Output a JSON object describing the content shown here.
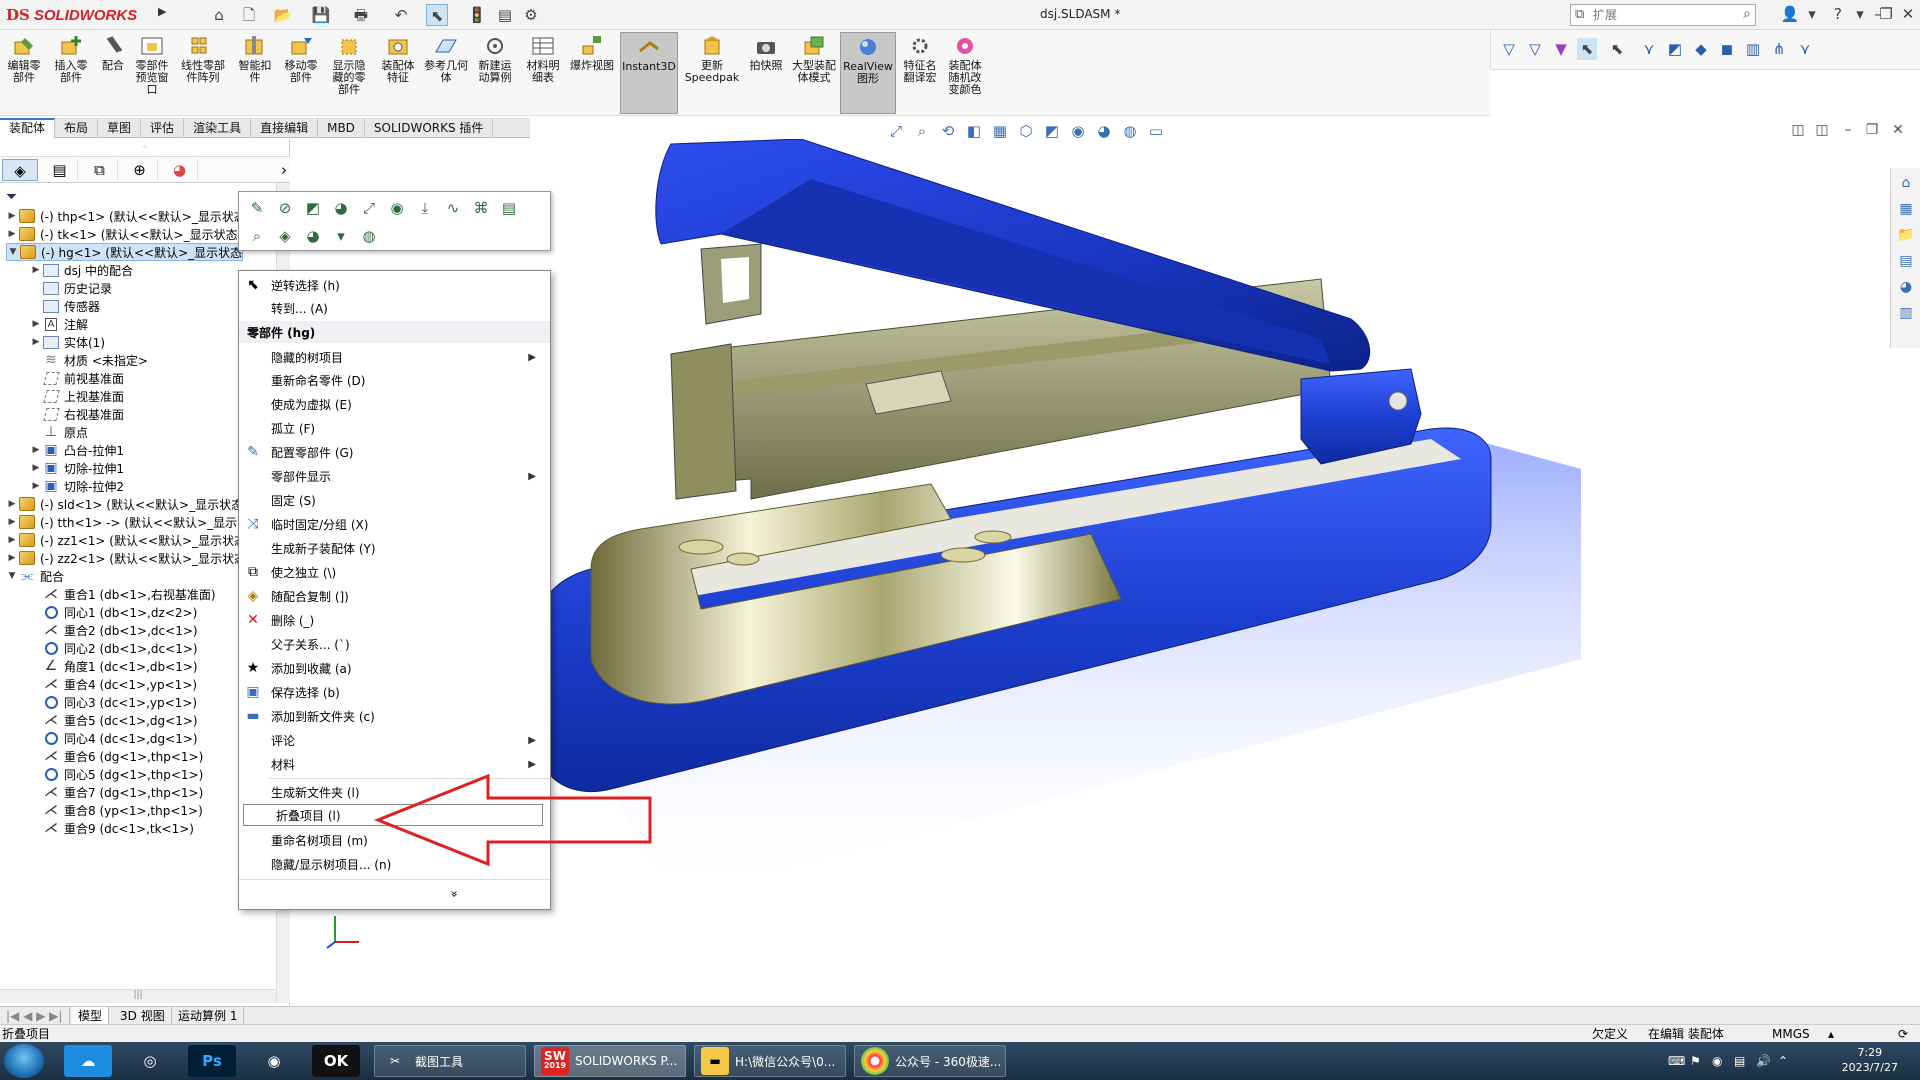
{
  "titlebar": {
    "brand_mark": "DS",
    "brand_name": "SOLIDWORKS",
    "doc_title": "dsj.SLDASM *",
    "search_placeholder": "扩展",
    "help_label": "?"
  },
  "command_manager": {
    "commands": [
      {
        "label": "编辑零部件"
      },
      {
        "label": "插入零部件"
      },
      {
        "label": "配合"
      },
      {
        "label": "零部件预览窗口"
      },
      {
        "label": "线性零部件阵列"
      },
      {
        "label": "智能扣件"
      },
      {
        "label": "移动零部件"
      },
      {
        "label": "显示隐藏的零部件"
      },
      {
        "label": "装配体特征"
      },
      {
        "label": "参考几何体"
      },
      {
        "label": "新建运动算例"
      },
      {
        "label": "材料明细表"
      },
      {
        "label": "爆炸视图"
      },
      {
        "label": "Instant3D"
      },
      {
        "label": "更新Speedpak"
      },
      {
        "label": "拍快照"
      },
      {
        "label": "大型装配体模式"
      },
      {
        "label": "RealView图形"
      },
      {
        "label": "特征名翻译宏"
      },
      {
        "label": "装配体随机改变颜色"
      }
    ]
  },
  "tabs": [
    "装配体",
    "布局",
    "草图",
    "评估",
    "渲染工具",
    "直接编辑",
    "MBD",
    "SOLIDWORKS 插件"
  ],
  "tree": {
    "items": [
      {
        "label": "(-) thp<1> (默认<<默认>_显示状态"
      },
      {
        "label": "(-) tk<1> (默认<<默认>_显示状态"
      },
      {
        "label": "(-) hg<1> (默认<<默认>_显示状态"
      },
      {
        "label": "dsj 中的配合"
      },
      {
        "label": "历史记录"
      },
      {
        "label": "传感器"
      },
      {
        "label": "注解"
      },
      {
        "label": "实体(1)"
      },
      {
        "label": "材质 <未指定>"
      },
      {
        "label": "前视基准面"
      },
      {
        "label": "上视基准面"
      },
      {
        "label": "右视基准面"
      },
      {
        "label": "原点"
      },
      {
        "label": "凸台-拉伸1"
      },
      {
        "label": "切除-拉伸1"
      },
      {
        "label": "切除-拉伸2"
      },
      {
        "label": "(-) sld<1> (默认<<默认>_显示状态"
      },
      {
        "label": "(-) tth<1> -> (默认<<默认>_显示"
      },
      {
        "label": "(-) zz1<1> (默认<<默认>_显示状态"
      },
      {
        "label": "(-) zz2<1> (默认<<默认>_显示状态"
      },
      {
        "label": "配合"
      },
      {
        "label": "重合1 (db<1>,右视基准面)"
      },
      {
        "label": "同心1 (db<1>,dz<2>)"
      },
      {
        "label": "重合2 (db<1>,dc<1>)"
      },
      {
        "label": "同心2 (db<1>,dc<1>)"
      },
      {
        "label": "角度1 (dc<1>,db<1>)"
      },
      {
        "label": "重合4 (dc<1>,yp<1>)"
      },
      {
        "label": "同心3 (dc<1>,yp<1>)"
      },
      {
        "label": "重合5 (dc<1>,dg<1>)"
      },
      {
        "label": "同心4 (dc<1>,dg<1>)"
      },
      {
        "label": "重合6 (dg<1>,thp<1>)"
      },
      {
        "label": "同心5 (dg<1>,thp<1>)"
      },
      {
        "label": "重合7 (dg<1>,thp<1>)"
      },
      {
        "label": "重合8 (yp<1>,thp<1>)"
      },
      {
        "label": "重合9 (dc<1>,tk<1>)"
      }
    ]
  },
  "context_menu": {
    "items": [
      {
        "label": "逆转选择 (h)"
      },
      {
        "label": "转到... (A)"
      },
      {
        "label": "零部件 (hg)"
      },
      {
        "label": "隐藏的树项目"
      },
      {
        "label": "重新命名零件 (D)"
      },
      {
        "label": "使成为虚拟 (E)"
      },
      {
        "label": "孤立 (F)"
      },
      {
        "label": "配置零部件 (G)"
      },
      {
        "label": "零部件显示"
      },
      {
        "label": "固定 (S)"
      },
      {
        "label": "临时固定/分组 (X)"
      },
      {
        "label": "生成新子装配体 (Y)"
      },
      {
        "label": "使之独立 (\\)"
      },
      {
        "label": "随配合复制 (])"
      },
      {
        "label": "删除 (_)"
      },
      {
        "label": "父子关系... (`)"
      },
      {
        "label": "添加到收藏 (a)"
      },
      {
        "label": "保存选择 (b)"
      },
      {
        "label": "添加到新文件夹 (c)"
      },
      {
        "label": "评论"
      },
      {
        "label": "材料"
      },
      {
        "label": "生成新文件夹 (l)"
      },
      {
        "label": "折叠项目 (l)"
      },
      {
        "label": "重命名树项目 (m)"
      },
      {
        "label": "隐藏/显示树项目... (n)"
      }
    ],
    "more_label": "»"
  },
  "bottom_tabs": [
    "模型",
    "3D 视图",
    "运动算例 1"
  ],
  "status": {
    "left": "折叠项目",
    "definition": "欠定义",
    "mode": "在编辑 装配体",
    "units": "MMGS"
  },
  "taskbar": {
    "tasks": [
      {
        "label": "截图工具"
      },
      {
        "label": "SOLIDWORKS P..."
      },
      {
        "label": "H:\\微信公众号\\0..."
      },
      {
        "label": "公众号 - 360极速..."
      }
    ],
    "ps_label": "Ps",
    "gom_label": "OK",
    "sw_year": "2019",
    "time": "7:29",
    "date": "2023/7/27"
  },
  "colors": {
    "accent": "#3b78c6",
    "stapler_blue": "#1d3fd1",
    "arrow_red": "#e02020",
    "taskbar": "#1b2f43"
  }
}
